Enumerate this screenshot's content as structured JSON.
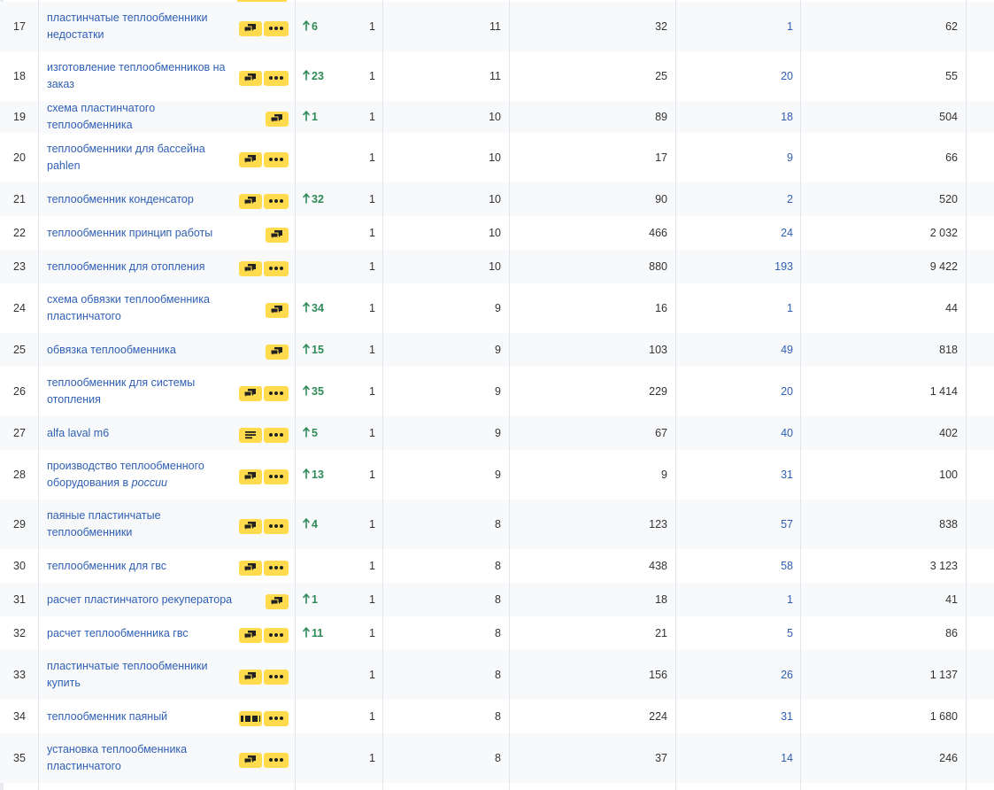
{
  "rows": [
    {
      "num": "17",
      "keyword": "пластинчатые теплообменники недостатки",
      "icon": "chat",
      "dots": true,
      "rise": "6",
      "col_a": "1",
      "col_b": "11",
      "col_c": "32",
      "col_d": "1",
      "col_e": "62"
    },
    {
      "num": "18",
      "keyword": "изготовление теплообменников на заказ",
      "icon": "chat",
      "dots": true,
      "rise": "23",
      "col_a": "1",
      "col_b": "11",
      "col_c": "25",
      "col_d": "20",
      "col_e": "55"
    },
    {
      "num": "19",
      "keyword": "схема пластинчатого теплообменника",
      "icon": "chat",
      "dots": false,
      "rise": "1",
      "col_a": "1",
      "col_b": "10",
      "col_c": "89",
      "col_d": "18",
      "col_e": "504"
    },
    {
      "num": "20",
      "keyword": "теплообменники для бассейна pahlen",
      "icon": "chat",
      "dots": true,
      "rise": "",
      "col_a": "1",
      "col_b": "10",
      "col_c": "17",
      "col_d": "9",
      "col_e": "66"
    },
    {
      "num": "21",
      "keyword": "теплообменник конденсатор",
      "icon": "chat",
      "dots": true,
      "rise": "32",
      "col_a": "1",
      "col_b": "10",
      "col_c": "90",
      "col_d": "2",
      "col_e": "520"
    },
    {
      "num": "22",
      "keyword": "теплообменник принцип работы",
      "icon": "chat",
      "dots": false,
      "rise": "",
      "col_a": "1",
      "col_b": "10",
      "col_c": "466",
      "col_d": "24",
      "col_e": "2 032"
    },
    {
      "num": "23",
      "keyword": "теплообменник для отопления",
      "icon": "chat",
      "dots": true,
      "rise": "",
      "col_a": "1",
      "col_b": "10",
      "col_c": "880",
      "col_d": "193",
      "col_e": "9 422"
    },
    {
      "num": "24",
      "keyword": "схема обвязки теплообменника пластинчатого",
      "icon": "chat",
      "dots": false,
      "rise": "34",
      "col_a": "1",
      "col_b": "9",
      "col_c": "16",
      "col_d": "1",
      "col_e": "44"
    },
    {
      "num": "25",
      "keyword": "обвязка теплообменника",
      "icon": "chat",
      "dots": false,
      "rise": "15",
      "col_a": "1",
      "col_b": "9",
      "col_c": "103",
      "col_d": "49",
      "col_e": "818"
    },
    {
      "num": "26",
      "keyword": "теплообменник для системы отопления",
      "icon": "chat",
      "dots": true,
      "rise": "35",
      "col_a": "1",
      "col_b": "9",
      "col_c": "229",
      "col_d": "20",
      "col_e": "1 414"
    },
    {
      "num": "27",
      "keyword": "alfa laval m6",
      "icon": "lines",
      "dots": true,
      "rise": "5",
      "col_a": "1",
      "col_b": "9",
      "col_c": "67",
      "col_d": "40",
      "col_e": "402"
    },
    {
      "num": "28",
      "keyword": "производство теплообменного оборудования в",
      "keyword_italic": "россии",
      "icon": "chat",
      "dots": true,
      "rise": "13",
      "col_a": "1",
      "col_b": "9",
      "col_c": "9",
      "col_d": "31",
      "col_e": "100"
    },
    {
      "num": "29",
      "keyword": "паяные пластинчатые теплообменники",
      "icon": "chat",
      "dots": true,
      "rise": "4",
      "col_a": "1",
      "col_b": "8",
      "col_c": "123",
      "col_d": "57",
      "col_e": "838"
    },
    {
      "num": "30",
      "keyword": "теплообменник для гвс",
      "icon": "chat",
      "dots": true,
      "rise": "",
      "col_a": "1",
      "col_b": "8",
      "col_c": "438",
      "col_d": "58",
      "col_e": "3 123"
    },
    {
      "num": "31",
      "keyword": "расчет пластинчатого рекуператора",
      "icon": "chat",
      "dots": false,
      "rise": "1",
      "col_a": "1",
      "col_b": "8",
      "col_c": "18",
      "col_d": "1",
      "col_e": "41"
    },
    {
      "num": "32",
      "keyword": "расчет теплообменника гвс",
      "icon": "chat",
      "dots": true,
      "rise": "11",
      "col_a": "1",
      "col_b": "8",
      "col_c": "21",
      "col_d": "5",
      "col_e": "86"
    },
    {
      "num": "33",
      "keyword": "пластинчатые теплообменники купить",
      "icon": "chat",
      "dots": true,
      "rise": "",
      "col_a": "1",
      "col_b": "8",
      "col_c": "156",
      "col_d": "26",
      "col_e": "1 137"
    },
    {
      "num": "34",
      "keyword": "теплообменник паяный",
      "icon": "film",
      "dots": true,
      "rise": "",
      "col_a": "1",
      "col_b": "8",
      "col_c": "224",
      "col_d": "31",
      "col_e": "1 680"
    },
    {
      "num": "35",
      "keyword": "установка теплообменника пластинчатого",
      "icon": "chat",
      "dots": true,
      "rise": "",
      "col_a": "1",
      "col_b": "8",
      "col_c": "37",
      "col_d": "14",
      "col_e": "246"
    }
  ],
  "colors": {
    "accent_yellow": "#ffdb4d",
    "link_blue": "#2f5fb5",
    "rise_green": "#2e8b57",
    "grid_line": "#e3e5ea"
  },
  "icons": {
    "chat": "chat-bubbles-icon",
    "lines": "text-lines-icon",
    "film": "filmstrip-icon",
    "dots": "more-dots-icon",
    "rise": "arrow-up-icon"
  }
}
